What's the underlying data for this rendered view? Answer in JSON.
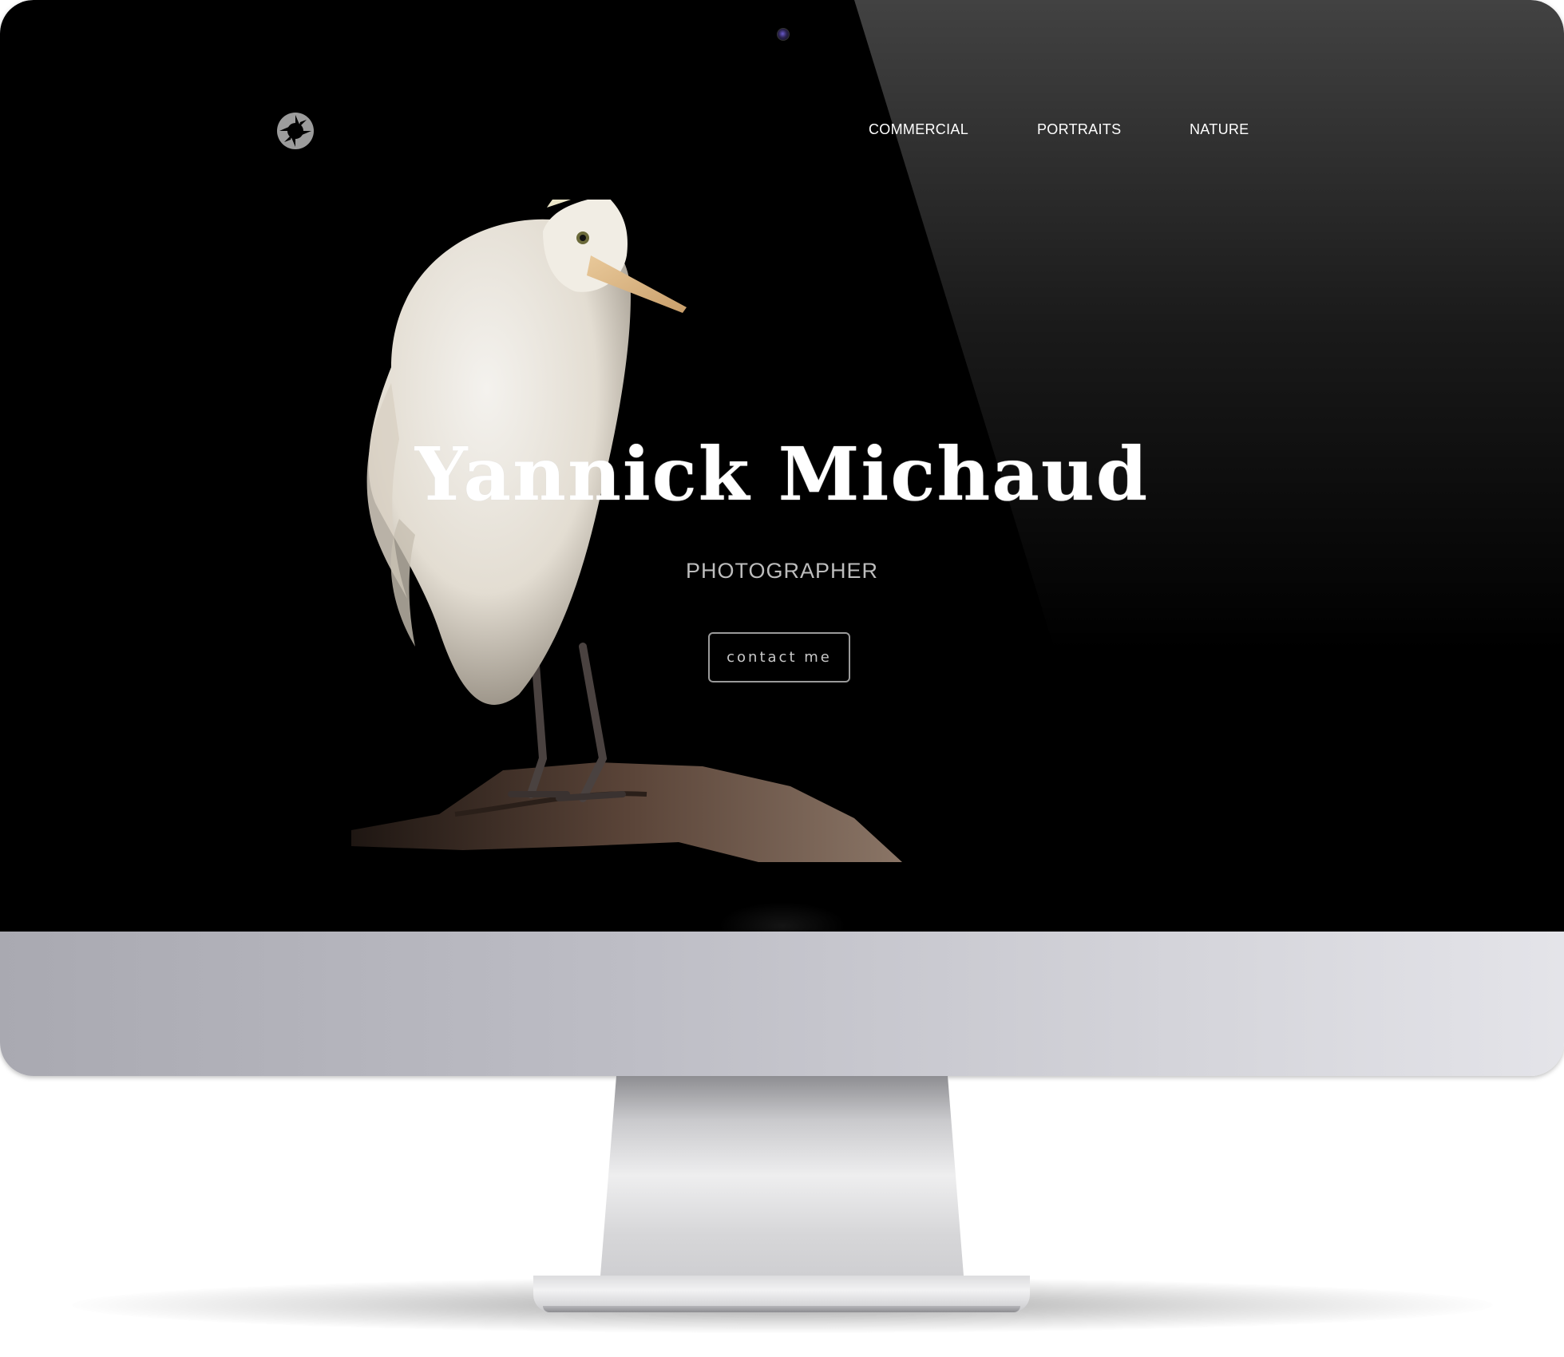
{
  "site": {
    "name": "Yannick Michaud",
    "tagline": "PHOTOGRAPHER"
  },
  "nav": {
    "items": [
      {
        "label": "COMMERCIAL"
      },
      {
        "label": "PORTRAITS"
      },
      {
        "label": "NATURE"
      }
    ]
  },
  "hero": {
    "contact_label": "contact me"
  },
  "icons": {
    "logo": "camera-aperture-icon"
  },
  "colors": {
    "background": "#000000",
    "text": "#ffffff",
    "subtitle": "#bdbdbd",
    "button_border": "#9a9a9a"
  }
}
